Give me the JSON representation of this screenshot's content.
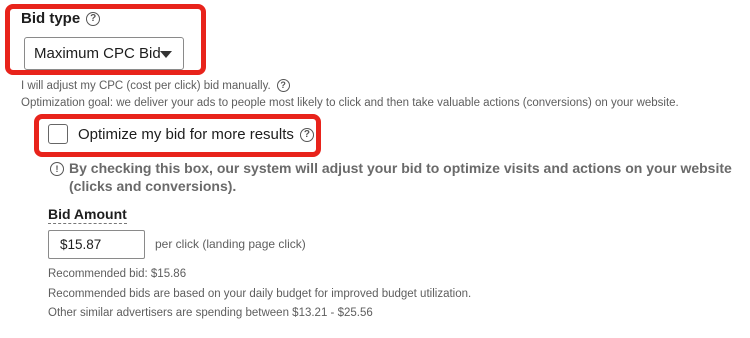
{
  "bid_type": {
    "title": "Bid type",
    "selected": "Maximum CPC Bid",
    "adjust_text": "I will adjust my CPC (cost per click) bid manually.",
    "goal_text": "Optimization goal: we deliver your ads to people most likely to click and then take valuable actions (conversions) on your website."
  },
  "optimize": {
    "label": "Optimize my bid for more results",
    "checked": false,
    "info_line_1": "By checking this box, our system will adjust your bid to optimize visits and actions on your website",
    "info_line_2": "(clicks and conversions)."
  },
  "bid_amount": {
    "title": "Bid Amount",
    "value": "$15.87",
    "unit_label": "per click (landing page click)",
    "recommended": "Recommended bid: $15.86",
    "explanation": "Recommended bids are based on your daily budget for improved budget utilization.",
    "range": "Other similar advertisers are spending between $13.21 - $25.56"
  },
  "icons": {
    "help": "?",
    "info": "!"
  },
  "colors": {
    "highlight": "#e8231b"
  }
}
